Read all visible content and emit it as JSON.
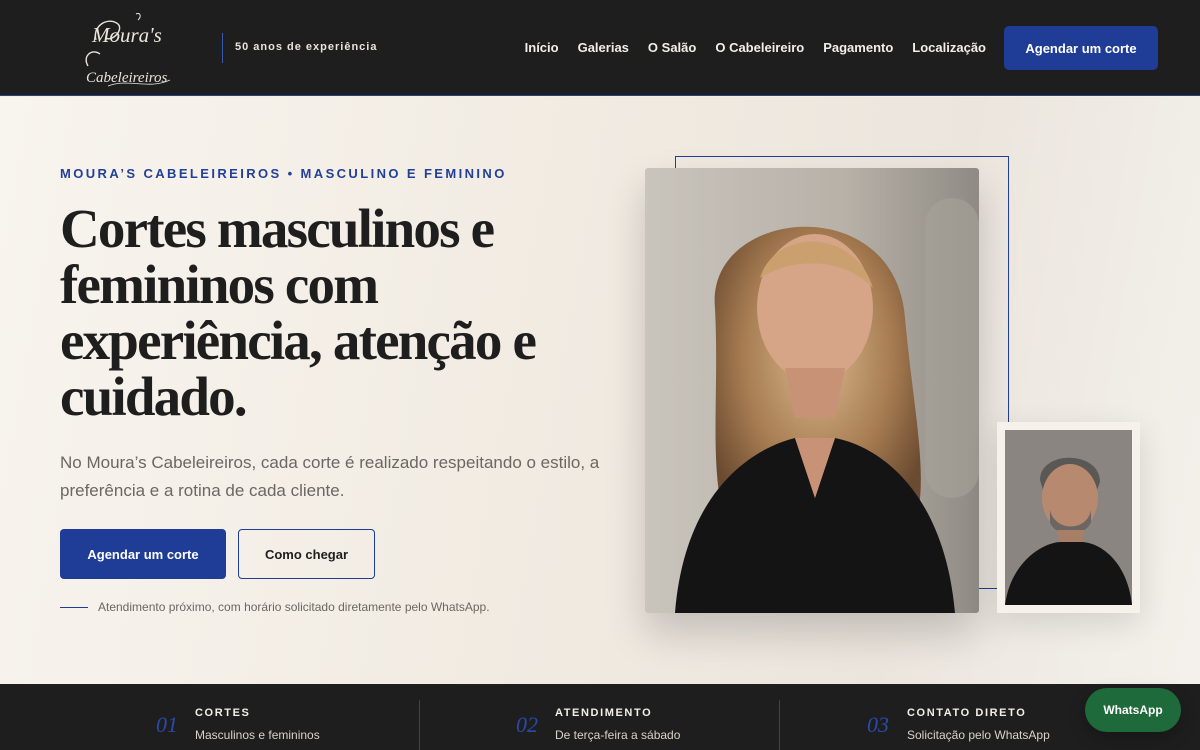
{
  "header": {
    "logo_text_line1": "Moura's",
    "logo_text_line2": "Cabeleireiros",
    "tagline": "50 anos de experiência",
    "nav": [
      "Início",
      "Galerias",
      "O Salão",
      "O Cabeleireiro",
      "Pagamento",
      "Localização"
    ],
    "cta_label": "Agendar um corte"
  },
  "hero": {
    "eyebrow": "MOURA’S CABELEIREIROS • MASCULINO E FEMININO",
    "headline": "Cortes masculinos e femininos com experiência, atenção e cuidado.",
    "lede": "No Moura’s Cabeleireiros, cada corte é realizado respeitando o estilo, a preferência e a rotina de cada cliente.",
    "primary_button": "Agendar um corte",
    "secondary_button": "Como chegar",
    "note": "Atendimento próximo, com horário solicitado diretamente pelo WhatsApp."
  },
  "features": [
    {
      "num": "01",
      "title": "CORTES",
      "sub": "Masculinos e femininos"
    },
    {
      "num": "02",
      "title": "ATENDIMENTO",
      "sub": "De terça-feira a sábado"
    },
    {
      "num": "03",
      "title": "CONTATO DIRETO",
      "sub": "Solicitação pelo WhatsApp"
    }
  ],
  "whatsapp_label": "WhatsApp",
  "colors": {
    "brand_blue": "#1f3c96",
    "dark": "#1e1e1e",
    "whatsapp_green": "#1e6a3a"
  }
}
